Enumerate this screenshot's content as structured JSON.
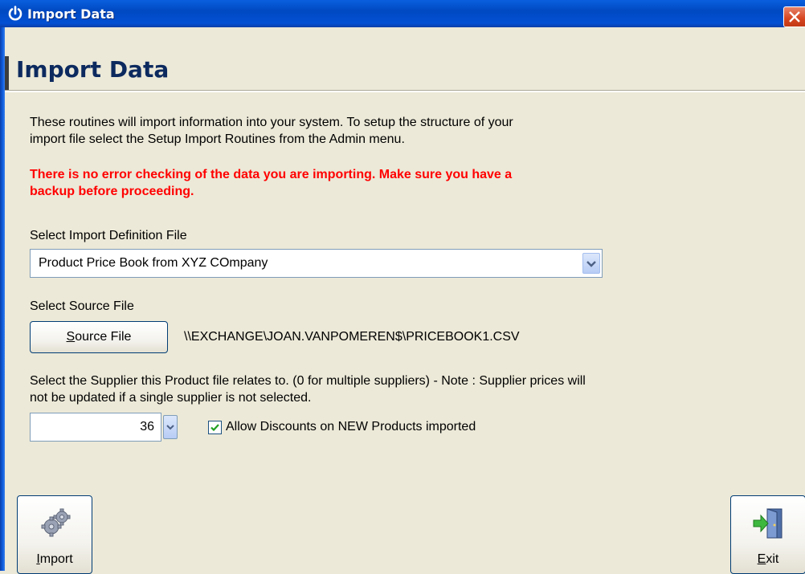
{
  "window": {
    "title": "Import Data",
    "title_icon": "power-icon",
    "close_icon": "close-icon"
  },
  "page": {
    "title": "Import Data"
  },
  "intro": {
    "line1": "These routines will import information into your system.  To setup the structure of your",
    "line2": "import file select the Setup Import Routines from the Admin menu."
  },
  "warning": {
    "line1": "There is no error checking of the data you are importing.  Make sure you have a",
    "line2": "backup before proceeding.",
    "color": "#FF0000"
  },
  "definition": {
    "label": "Select Import Definition File",
    "selected": "Product Price Book from XYZ COmpany"
  },
  "source": {
    "label": "Select Source File",
    "button_label": "ource File",
    "button_mnemonic": "S",
    "path": "\\\\EXCHANGE\\JOAN.VANPOMEREN$\\PRICEBOOK1.CSV"
  },
  "supplier": {
    "line1": "Select the Supplier this Product file relates to. (0 for multiple suppliers) - Note : Supplier prices will",
    "line2": "not be updated if a single supplier is not selected.",
    "value": "36"
  },
  "discount": {
    "label": "Allow Discounts on NEW Products imported",
    "checked": true
  },
  "actions": {
    "import_mnemonic": "I",
    "import_rest": "mport",
    "import_icon": "gears-icon",
    "exit_mnemonic": "E",
    "exit_rest": "xit",
    "exit_icon": "exit-door-icon"
  },
  "colors": {
    "title_bar": "#0A5FDE",
    "heading": "#0D2A5F",
    "background": "#ECE9D8"
  }
}
